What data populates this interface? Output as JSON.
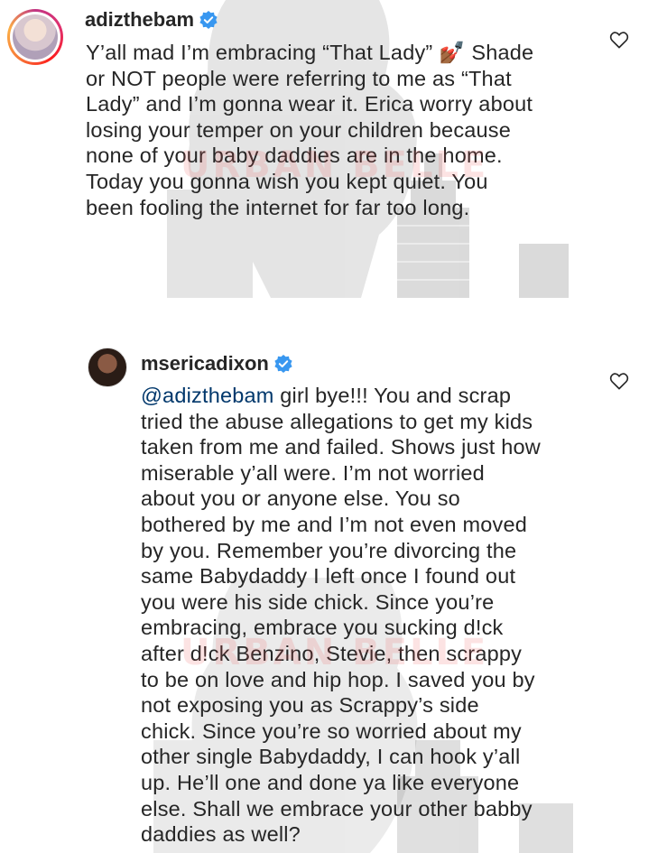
{
  "watermark": {
    "text": "URBAN BELLE"
  },
  "comments": [
    {
      "username": "adizthebam",
      "verified": true,
      "text_lines": [
        "Y’all mad I’m embracing “That Lady” 💅🏾 Shade",
        "or NOT people were referring to me as “That",
        "Lady” and I’m gonna wear it. Erica worry about",
        "losing your temper on your children because",
        "none of your baby daddies are in the home.",
        "Today you gonna wish you kept quiet. You",
        "been fooling the internet for far too long."
      ],
      "like_icon": "heart-outline-icon"
    },
    {
      "username": "msericadixon",
      "verified": true,
      "mention": "@adizthebam",
      "first_line_rest": " girl bye!!! You and scrap",
      "text_lines": [
        "tried the abuse allegations to get my kids",
        "taken from me and failed. Shows just how",
        "miserable y’all were. I’m not worried",
        "about you or anyone else. You so",
        "bothered by me and I’m not even moved",
        "by you. Remember you’re divorcing the",
        "same Babydaddy I left once I found out",
        "you were his side chick. Since you’re",
        "embracing, embrace you sucking d!ck",
        "after d!ck Benzino, Stevie, then scrappy",
        "to be on love and hip hop. I saved you by",
        "not exposing you as Scrappy’s  side",
        "chick. Since you’re so worried about my",
        "other single Babydaddy, I can hook y’all",
        "up. He’ll one and done ya like everyone",
        "else. Shall we embrace your other babby",
        "daddies as well?"
      ],
      "like_icon": "heart-outline-icon"
    }
  ],
  "colors": {
    "verified": "#3897f0",
    "mention": "#00376b",
    "text": "#262626"
  }
}
